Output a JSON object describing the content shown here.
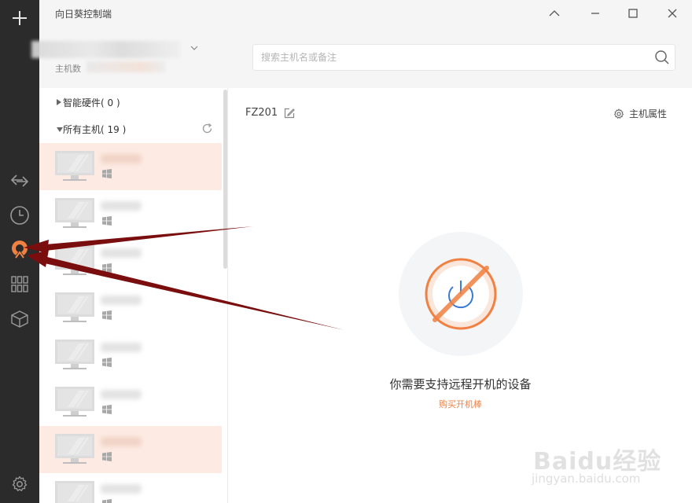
{
  "window": {
    "title": "向日葵控制端"
  },
  "account": {
    "sub_label": "主机数"
  },
  "search": {
    "placeholder": "搜索主机名或备注"
  },
  "groups": {
    "smart_hardware": "智能硬件( 0 )",
    "all_hosts": "所有主机( 19 )"
  },
  "hosts": [
    {
      "selected": true
    },
    {
      "selected": false
    },
    {
      "selected": false
    },
    {
      "selected": false
    },
    {
      "selected": false
    },
    {
      "selected": false
    },
    {
      "selected": true
    },
    {
      "selected": false
    }
  ],
  "detail": {
    "host_name": "FZ201",
    "properties_label": "主机属性",
    "message": "你需要支持远程开机的设备",
    "buy_link": "购买开机棒"
  },
  "sidebar_icons": [
    "plus-icon",
    "transfer-icon",
    "clock-icon",
    "remote-boot-icon",
    "apps-grid-icon",
    "box-icon",
    "settings-gear-icon"
  ],
  "colors": {
    "rail": "#2b2b2b",
    "accent": "#f08143",
    "selected_row": "#fdebe3",
    "arrow": "#7a0d0d"
  },
  "watermark": {
    "brand": "Baidu经验",
    "url": "jingyan.baidu.com"
  }
}
